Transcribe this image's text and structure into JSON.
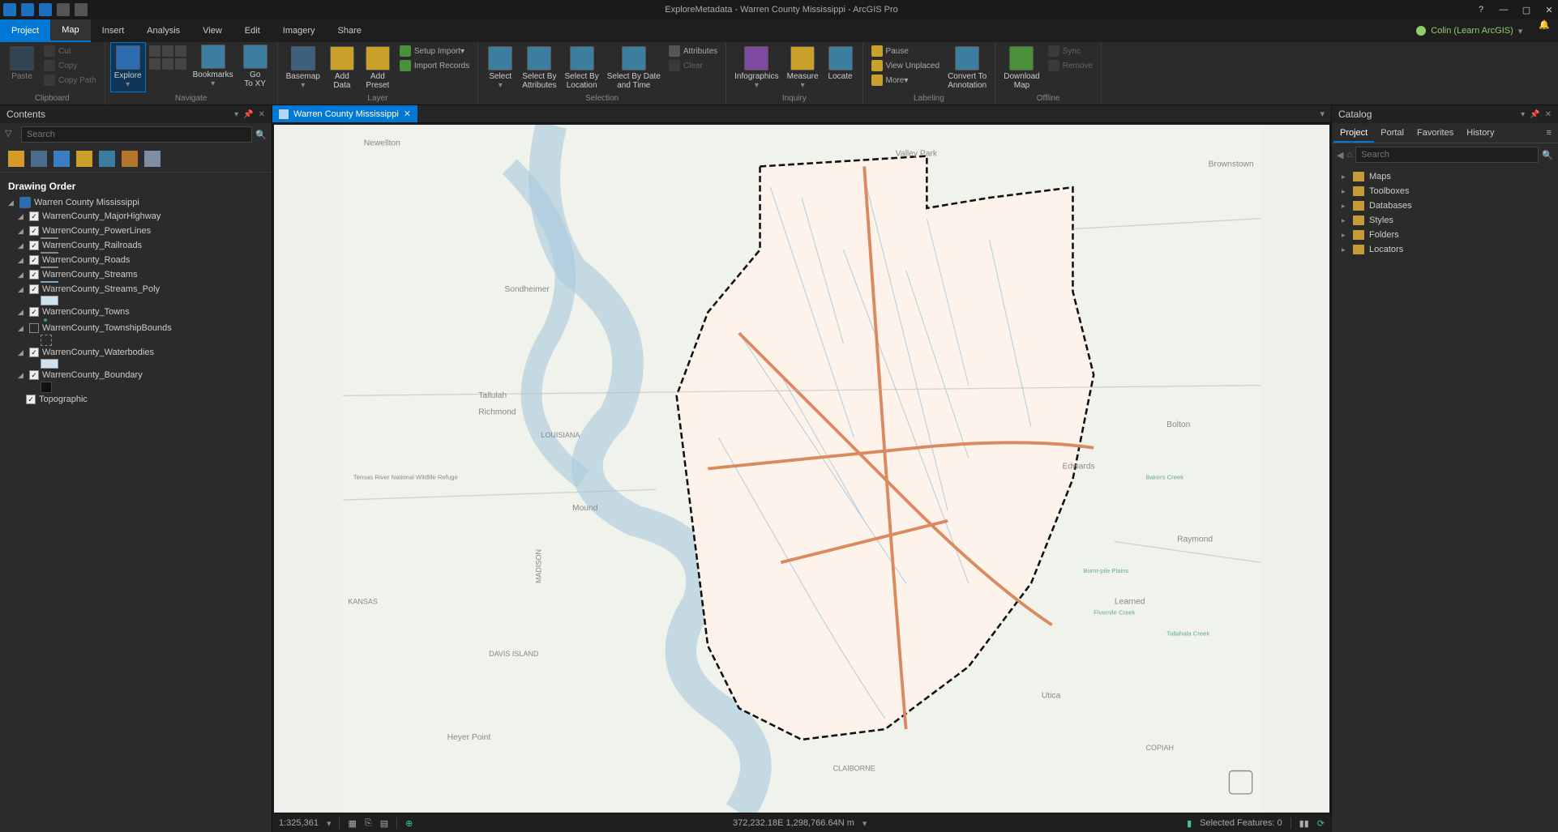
{
  "titlebar": {
    "title": "ExploreMetadata - Warren County Mississippi - ArcGIS Pro"
  },
  "user": {
    "name": "Colin (Learn ArcGIS)"
  },
  "main_tabs": {
    "project": "Project",
    "map": "Map",
    "insert": "Insert",
    "analysis": "Analysis",
    "view": "View",
    "edit": "Edit",
    "imagery": "Imagery",
    "share": "Share"
  },
  "ribbon": {
    "clipboard": {
      "label": "Clipboard",
      "paste": "Paste",
      "cut": "Cut",
      "copy": "Copy",
      "copypath": "Copy Path"
    },
    "navigate": {
      "label": "Navigate",
      "explore": "Explore",
      "bookmarks": "Bookmarks",
      "goto": "Go\nTo XY"
    },
    "layer": {
      "label": "Layer",
      "basemap": "Basemap",
      "adddata": "Add\nData",
      "addpreset": "Add\nPreset",
      "setupimport": "Setup Import",
      "importrecords": "Import Records"
    },
    "selection": {
      "label": "Selection",
      "select": "Select",
      "selbyattr": "Select By\nAttributes",
      "selbyloc": "Select By\nLocation",
      "selbydate": "Select By Date\nand Time",
      "attributes": "Attributes",
      "clear": "Clear"
    },
    "inquiry": {
      "label": "Inquiry",
      "infographics": "Infographics",
      "measure": "Measure",
      "locate": "Locate"
    },
    "labeling": {
      "label": "Labeling",
      "pause": "Pause",
      "viewunplaced": "View Unplaced",
      "more": "More",
      "convert": "Convert To\nAnnotation"
    },
    "offline": {
      "label": "Offline",
      "download": "Download\nMap",
      "sync": "Sync",
      "remove": "Remove"
    }
  },
  "contents": {
    "title": "Contents",
    "search_placeholder": "Search",
    "heading": "Drawing Order",
    "map_name": "Warren County Mississippi",
    "layers": [
      {
        "name": "WarrenCounty_MajorHighway",
        "checked": true,
        "sym": "line-orange"
      },
      {
        "name": "WarrenCounty_PowerLines",
        "checked": true,
        "sym": "line-gray"
      },
      {
        "name": "WarrenCounty_Railroads",
        "checked": true,
        "sym": "line-gray"
      },
      {
        "name": "WarrenCounty_Roads",
        "checked": true,
        "sym": "line-gray"
      },
      {
        "name": "WarrenCounty_Streams",
        "checked": true,
        "sym": "line-blue"
      },
      {
        "name": "WarrenCounty_Streams_Poly",
        "checked": true,
        "sym": "fill-ltblue"
      },
      {
        "name": "WarrenCounty_Towns",
        "checked": true,
        "sym": "dot-green"
      },
      {
        "name": "WarrenCounty_TownshipBounds",
        "checked": false,
        "sym": "dash-box"
      },
      {
        "name": "WarrenCounty_Waterbodies",
        "checked": true,
        "sym": "fill-ltblue"
      },
      {
        "name": "WarrenCounty_Boundary",
        "checked": true,
        "sym": "fill-black"
      }
    ],
    "basemap": "Topographic"
  },
  "map": {
    "tab": "Warren County Mississippi",
    "scale": "1:325,361",
    "coords": "372,232.18E 1,298,766.64N m",
    "selected": "Selected Features: 0",
    "labels": {
      "valleypark": "Valley Park",
      "sondheimer": "Sondheimer",
      "louisiana": "LOUISIANA",
      "tallulah": "Tallulah",
      "richmond": "Richmond",
      "mound": "Mound",
      "edwards": "Edwards",
      "bolton": "Bolton",
      "raymond": "Raymond",
      "learned": "Learned",
      "utica": "Utica",
      "copiah": "COPIAH",
      "claiborne": "CLAIBORNE",
      "newellton": "Newellton",
      "arkansas": "KANSAS",
      "madison": "MADISON",
      "davis": "DAVIS ISLAND",
      "tensas": "Tensas River National Wildlife Refuge",
      "brownstown": "Brownstown",
      "hpoint": "Heyer Point",
      "bakers": "Bakers Creek",
      "tallahala": "Tallahala Creek",
      "burnt": "Burnt-pile Plains",
      "five": "Fivemile Creek"
    }
  },
  "catalog": {
    "title": "Catalog",
    "tabs": {
      "project": "Project",
      "portal": "Portal",
      "favorites": "Favorites",
      "history": "History"
    },
    "search_placeholder": "Search",
    "items": [
      "Maps",
      "Toolboxes",
      "Databases",
      "Styles",
      "Folders",
      "Locators"
    ]
  }
}
